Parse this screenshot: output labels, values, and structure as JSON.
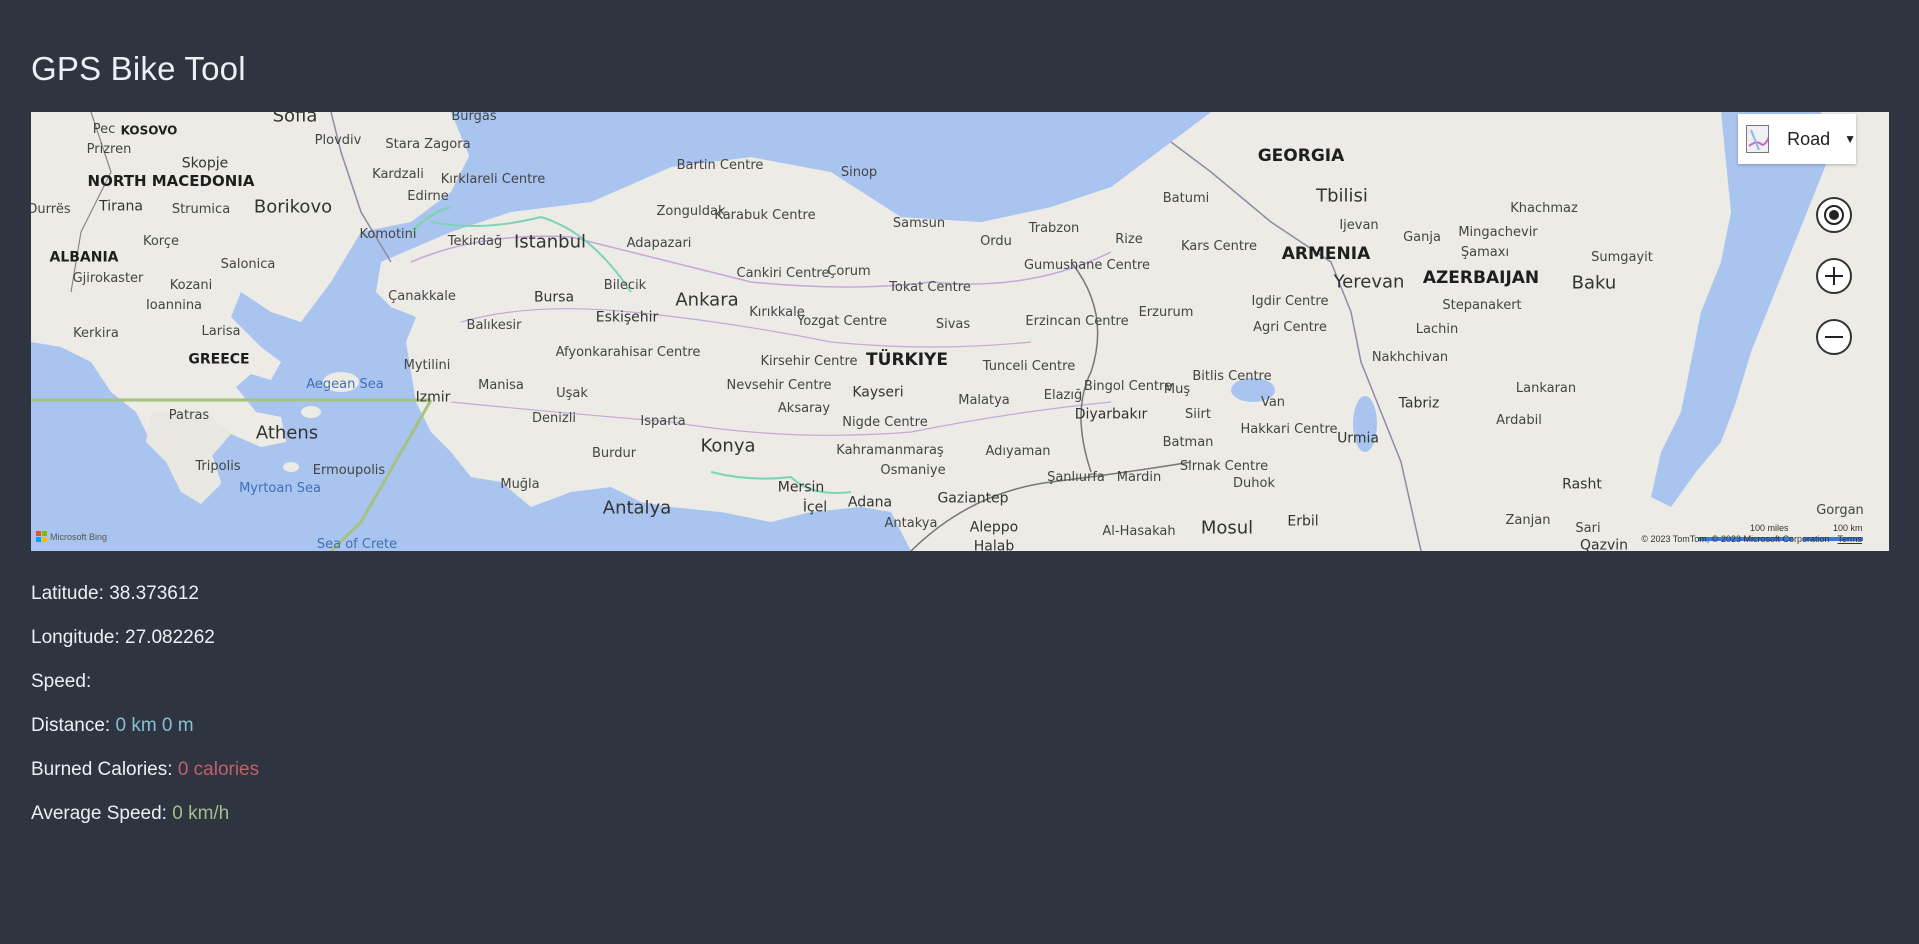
{
  "app": {
    "title": "GPS Bike Tool"
  },
  "map": {
    "style_selector": {
      "label": "Road"
    },
    "attribution": "Microsoft Bing",
    "copyright": "© 2023 TomTom, © 2023 Microsoft Corporation",
    "terms": "Terms",
    "scale": {
      "miles": "100 miles",
      "km": "100 km"
    },
    "countries": [
      "KOSOVO",
      "NORTH MACEDONIA",
      "ALBANIA",
      "GREECE",
      "TÜRKIYE",
      "GEORGIA",
      "ARMENIA",
      "AZERBAIJAN"
    ],
    "cities": [
      "Sofia",
      "Burgas",
      "Prizren",
      "Skopje",
      "Plovdiv",
      "Stara Zagora",
      "Kırklareli Centre",
      "Edirne",
      "Kardzali",
      "Borikovo",
      "Strumica",
      "Tirana",
      "Korçe",
      "Salonica",
      "Komotini",
      "Tekirdağ",
      "Istanbul",
      "Adapazari",
      "Zonguldak",
      "Karabuk Centre",
      "Bartin Centre",
      "Sinop",
      "Samsun",
      "Ordu",
      "Trabzon",
      "Rize",
      "Batumi",
      "Tbilisi",
      "Khachmaz",
      "Ijevan",
      "Ganja",
      "Mingachevir",
      "Şamaxı",
      "Sumgayit",
      "Baku",
      "Gjirokaster",
      "Kozani",
      "Ioannina",
      "Larisa",
      "Kerkira",
      "Çanakkale",
      "Bursa",
      "Bilecik",
      "Ankara",
      "Cankiri Centre",
      "Çorum",
      "Tokat Centre",
      "Gumushane Centre",
      "Kars Centre",
      "Yerevan",
      "Stepanakert",
      "Balıkesir",
      "Eskişehir",
      "Kırıkkale",
      "Yozgat Centre",
      "Sivas",
      "Erzincan Centre",
      "Erzurum",
      "Igdir Centre",
      "Agri Centre",
      "Lachin",
      "Mytilini",
      "Afyonkarahisar Centre",
      "Kirsehir Centre",
      "Tunceli Centre",
      "Bingol Centre",
      "Bitlis Centre",
      "Nakhchivan",
      "Izmir",
      "Manisa",
      "Uşak",
      "Nevsehir Centre",
      "Kayseri",
      "Malatya",
      "Elazığ",
      "Muş",
      "Van",
      "Tabriz",
      "Lankaran",
      "Patras",
      "Athens",
      "Denizli",
      "Isparta",
      "Aksaray",
      "Nigde Centre",
      "Diyarbakır",
      "Siirt",
      "Hakkari Centre",
      "Urmia",
      "Ardabil",
      "Tripolis",
      "Ermoupolis",
      "Burdur",
      "Konya",
      "Kahramanmaraş",
      "Adıyaman",
      "Batman",
      "Osmaniye",
      "Şanlıurfa",
      "Mardin",
      "Sirnak Centre",
      "Duhok",
      "Rasht",
      "Muğla",
      "Antalya",
      "Mersin",
      "İçel",
      "Adana",
      "Gaziantep",
      "Antakya",
      "Aleppo",
      "Halab",
      "Al-Hasakah",
      "Mosul",
      "Erbil",
      "Zanjan",
      "Gorgan",
      "Sari",
      "Qazvin",
      "Durrës",
      "Pec"
    ],
    "waters": [
      "Aegean Sea",
      "Myrtoan Sea",
      "Sea of Crete"
    ]
  },
  "stats": {
    "latitude_label": "Latitude:",
    "latitude_value": "38.373612",
    "longitude_label": "Longitude:",
    "longitude_value": "27.082262",
    "speed_label": "Speed:",
    "speed_value": "",
    "distance_label": "Distance:",
    "distance_value": "0 km 0 m",
    "calories_label": "Burned Calories:",
    "calories_value": "0 calories",
    "avg_speed_label": "Average Speed:",
    "avg_speed_value": "0 km/h"
  },
  "colors": {
    "background": "#2e3440",
    "text": "#eceff4",
    "distance": "#88c0d0",
    "calories": "#bf616a",
    "average_speed": "#a3be8c",
    "sea": "#a9c5ef",
    "land": "#ecebe6"
  }
}
